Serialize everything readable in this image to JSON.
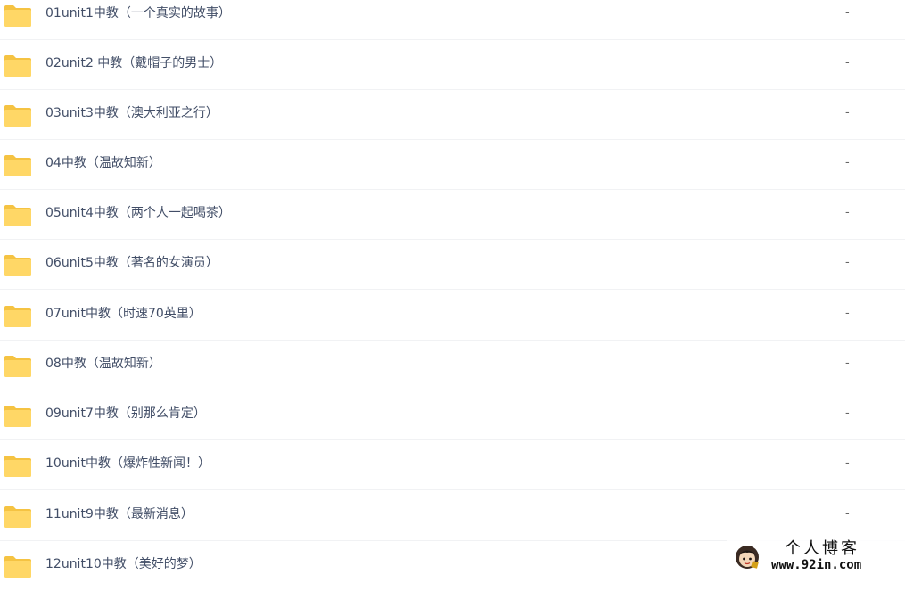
{
  "files": [
    {
      "name": "01unit1中教（一个真实的故事）",
      "size": "-",
      "icon": "folder-icon"
    },
    {
      "name": "02unit2 中教（戴帽子的男士）",
      "size": "-",
      "icon": "folder-icon"
    },
    {
      "name": "03unit3中教（澳大利亚之行）",
      "size": "-",
      "icon": "folder-icon"
    },
    {
      "name": "04中教（温故知新）",
      "size": "-",
      "icon": "folder-icon"
    },
    {
      "name": "05unit4中教（两个人一起喝茶）",
      "size": "-",
      "icon": "folder-icon"
    },
    {
      "name": "06unit5中教（著名的女演员）",
      "size": "-",
      "icon": "folder-icon"
    },
    {
      "name": "07unit中教（时速70英里）",
      "size": "-",
      "icon": "folder-icon"
    },
    {
      "name": "08中教（温故知新）",
      "size": "-",
      "icon": "folder-icon"
    },
    {
      "name": "09unit7中教（别那么肯定）",
      "size": "-",
      "icon": "folder-icon"
    },
    {
      "name": "10unit中教（爆炸性新闻！）",
      "size": "-",
      "icon": "folder-icon"
    },
    {
      "name": "11unit9中教（最新消息）",
      "size": "-",
      "icon": "folder-icon"
    },
    {
      "name": "12unit10中教（美好的梦）",
      "size": "-",
      "icon": "folder-icon"
    }
  ],
  "watermark": {
    "title": "个人博客",
    "url": "www.92in.com"
  },
  "colors": {
    "folder_body": "#ffd766",
    "folder_back": "#f5c342",
    "text": "#424e67",
    "row_border": "#f1f2f4"
  }
}
